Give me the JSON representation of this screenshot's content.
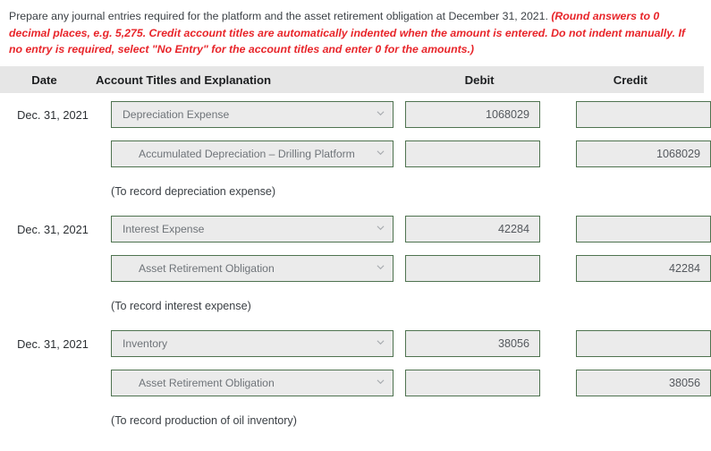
{
  "instructions": {
    "prompt": "Prepare any journal entries required for the platform and the asset retirement obligation at December 31, 2021. ",
    "hint": "(Round answers to 0 decimal places, e.g. 5,275. Credit account titles are automatically indented when the amount is entered. Do not indent manually. If no entry is required, select \"No Entry\" for the account titles and enter 0 for the amounts.)",
    "hint_color": "#e8252a"
  },
  "table": {
    "headers": {
      "date": "Date",
      "account": "Account Titles and Explanation",
      "debit": "Debit",
      "credit": "Credit"
    },
    "header_background": "#e6e6e6",
    "field_border_color": "#4f7350",
    "field_background": "#ebebeb",
    "dropdown_icon": "chevron-down-icon",
    "entries": [
      {
        "date": "Dec. 31, 2021",
        "debit_line": {
          "account": "Depreciation Expense",
          "debit": "1068029",
          "credit": ""
        },
        "credit_line": {
          "account": "Accumulated Depreciation – Drilling Platform",
          "debit": "",
          "credit": "1068029"
        },
        "memo": "(To record depreciation expense)"
      },
      {
        "date": "Dec. 31, 2021",
        "debit_line": {
          "account": "Interest Expense",
          "debit": "42284",
          "credit": ""
        },
        "credit_line": {
          "account": "Asset Retirement Obligation",
          "debit": "",
          "credit": "42284"
        },
        "memo": "(To record interest expense)"
      },
      {
        "date": "Dec. 31, 2021",
        "debit_line": {
          "account": "Inventory",
          "debit": "38056",
          "credit": ""
        },
        "credit_line": {
          "account": "Asset Retirement Obligation",
          "debit": "",
          "credit": "38056"
        },
        "memo": "(To record production of oil inventory)"
      }
    ]
  }
}
